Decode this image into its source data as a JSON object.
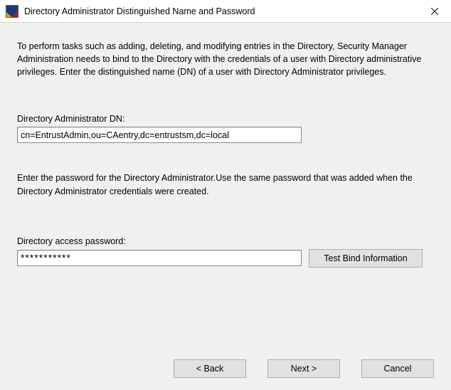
{
  "titlebar": {
    "title": "Directory Administrator Distinguished Name and Password"
  },
  "intro_text": "To perform tasks such as adding, deleting, and modifying entries in the Directory, Security Manager Administration needs to bind to the Directory with the credentials of a user with Directory administrative privileges. Enter the distinguished name (DN) of a user with Directory Administrator privileges.",
  "dn": {
    "label": "Directory Administrator DN:",
    "value": "cn=EntrustAdmin,ou=CAentry,dc=entrustsm,dc=local"
  },
  "password_section_text": "Enter the password for the Directory Administrator.Use the same password that was added when the Directory Administrator credentials were created.",
  "password": {
    "label": "Directory access password:",
    "masked_value": "***********"
  },
  "buttons": {
    "test_bind": "Test Bind Information",
    "back": "< Back",
    "next": "Next >",
    "cancel": "Cancel"
  }
}
